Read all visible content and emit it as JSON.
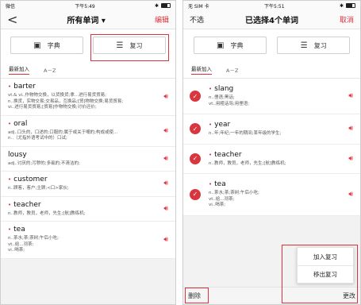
{
  "left_screen": {
    "status": {
      "carrier": "微信",
      "time": "下午5:49"
    },
    "nav": {
      "back": "<",
      "title": "所有单词 ▾",
      "edit": "编辑"
    },
    "actions": {
      "dictionary": "字典",
      "review": "复习"
    },
    "tabs": [
      "最新加入",
      "A－Z"
    ],
    "words": [
      {
        "word": "barter",
        "def": "vt.& vi..作物物交换，以货换货;拿...进行易货贸易;\nn..换货，实物交易;交易品，互换品;[贸]物物交换;易货贸易;\nvi..进行易货贸易;[贸易]作物物交换;讨价还价;"
      },
      {
        "word": "oral",
        "def": "adj..口头的，口述的;口服的;属于或关于嘴的;构成或使...\nn..（尤指外语考试中的）口试;"
      },
      {
        "word": "lousy",
        "def": "adj..讨厌的;污秽的;多虱的;不清洁的;"
      },
      {
        "word": "customer",
        "def": "n..顾客，客户;主顾;<口>家伙;"
      },
      {
        "word": "teacher",
        "def": "n..教师，教员，老师，先生;[航]教练机;"
      },
      {
        "word": "tea",
        "def": "n..茶水;茶;茶树;午后小吃;\nvt..给...沏茶;\nvi..喝茶;"
      }
    ]
  },
  "right_screen": {
    "status": {
      "carrier": "无 SIM 卡",
      "time": "下午5:51"
    },
    "nav": {
      "deselect": "不选",
      "title": "已选择4个单词",
      "cancel": "取消"
    },
    "actions": {
      "dictionary": "字典",
      "review": "复习"
    },
    "tabs": [
      "最新加入",
      "A－Z"
    ],
    "words": [
      {
        "word": "slang",
        "def": "n..俚语;黑话;\nvt..用粗话骂;用俚语;"
      },
      {
        "word": "year",
        "def": "n..年;年纪;一年的期间;某年级的学生;"
      },
      {
        "word": "teacher",
        "def": "n..教师，教员，老师，先生;[航]教练机;"
      },
      {
        "word": "tea",
        "def": "n..茶水;茶;茶树;午后小吃;\nvt..给...沏茶;\nvi..喝茶;"
      }
    ],
    "popup": [
      "加入复习",
      "移出复习"
    ],
    "bottom": {
      "delete": "删除",
      "change": "更改"
    }
  },
  "colors": {
    "accent": "#e0303a"
  }
}
